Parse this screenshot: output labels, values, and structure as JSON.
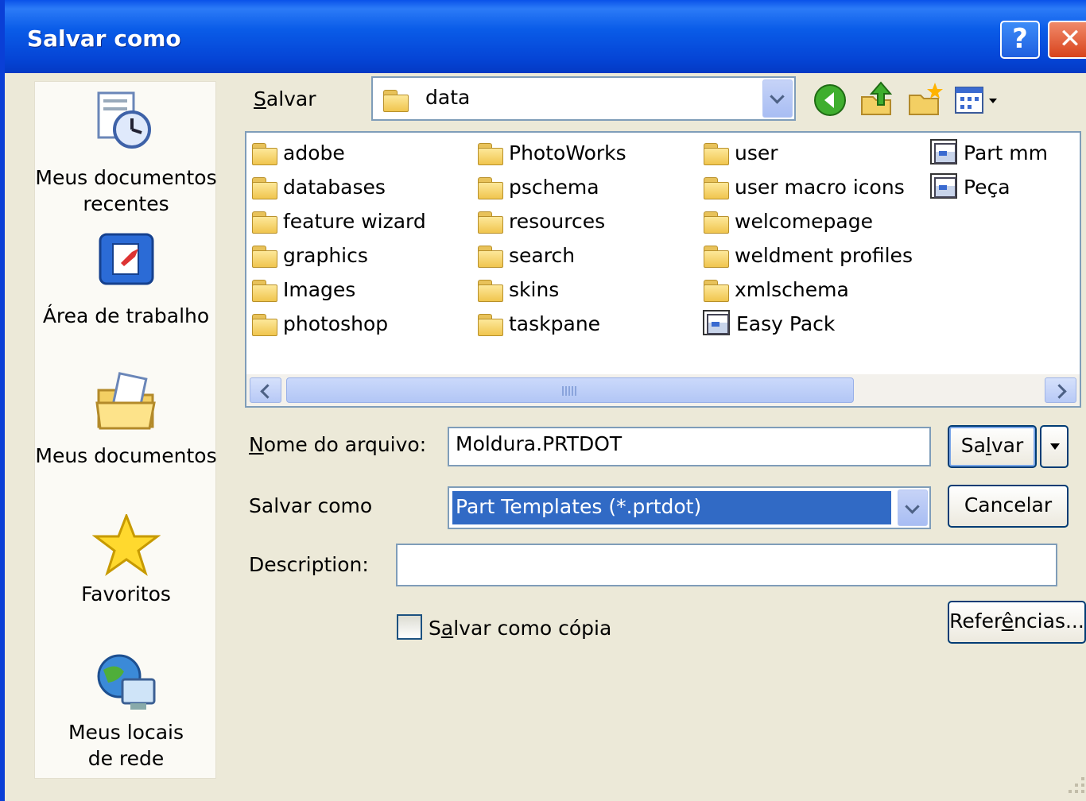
{
  "window": {
    "title": "Salvar como"
  },
  "places": [
    {
      "label_line1": "Meus documentos",
      "label_line2": "recentes",
      "icon": "recent-documents-icon"
    },
    {
      "label_line1": "Área de trabalho",
      "label_line2": "",
      "icon": "desktop-icon"
    },
    {
      "label_line1": "Meus documentos",
      "label_line2": "",
      "icon": "my-documents-icon"
    },
    {
      "label_line1": "Favoritos",
      "label_line2": "",
      "icon": "favorites-star-icon"
    },
    {
      "label_line1": "Meus locais",
      "label_line2": "de rede",
      "icon": "network-places-icon"
    }
  ],
  "save_in": {
    "label_underline": "S",
    "label_rest": "alvar",
    "value": "data"
  },
  "files": [
    {
      "name": "adobe",
      "type": "folder"
    },
    {
      "name": "databases",
      "type": "folder"
    },
    {
      "name": "feature wizard",
      "type": "folder"
    },
    {
      "name": "graphics",
      "type": "folder"
    },
    {
      "name": "Images",
      "type": "folder"
    },
    {
      "name": "photoshop",
      "type": "folder"
    },
    {
      "name": "PhotoWorks",
      "type": "folder"
    },
    {
      "name": "pschema",
      "type": "folder"
    },
    {
      "name": "resources",
      "type": "folder"
    },
    {
      "name": "search",
      "type": "folder"
    },
    {
      "name": "skins",
      "type": "folder"
    },
    {
      "name": "taskpane",
      "type": "folder"
    },
    {
      "name": "user",
      "type": "folder"
    },
    {
      "name": "user macro icons",
      "type": "folder"
    },
    {
      "name": "welcomepage",
      "type": "folder"
    },
    {
      "name": "weldment profiles",
      "type": "folder"
    },
    {
      "name": "xmlschema",
      "type": "folder"
    },
    {
      "name": "Easy Pack",
      "type": "template"
    },
    {
      "name": "Part mm",
      "type": "template"
    },
    {
      "name": "Peça",
      "type": "template"
    }
  ],
  "filename": {
    "label_underline": "N",
    "label_rest": "ome do arquivo:",
    "value": "Moldura.PRTDOT"
  },
  "save_as_type": {
    "label": "Salvar como",
    "value": "Part Templates (*.prtdot)"
  },
  "description": {
    "label": "Description:",
    "value": ""
  },
  "save_copy": {
    "label_pre": "S",
    "label_underline": "a",
    "label_rest": "lvar como cópia",
    "checked": false
  },
  "buttons": {
    "save_pre": "Sa",
    "save_underline": "l",
    "save_rest": "var",
    "cancel": "Cancelar",
    "refs_pre": "Refer",
    "refs_underline": "ê",
    "refs_rest": "ncias..."
  },
  "colors": {
    "titlebar": "#0a52e9",
    "selection": "#316ac5",
    "dialog_bg": "#ece9d8"
  }
}
